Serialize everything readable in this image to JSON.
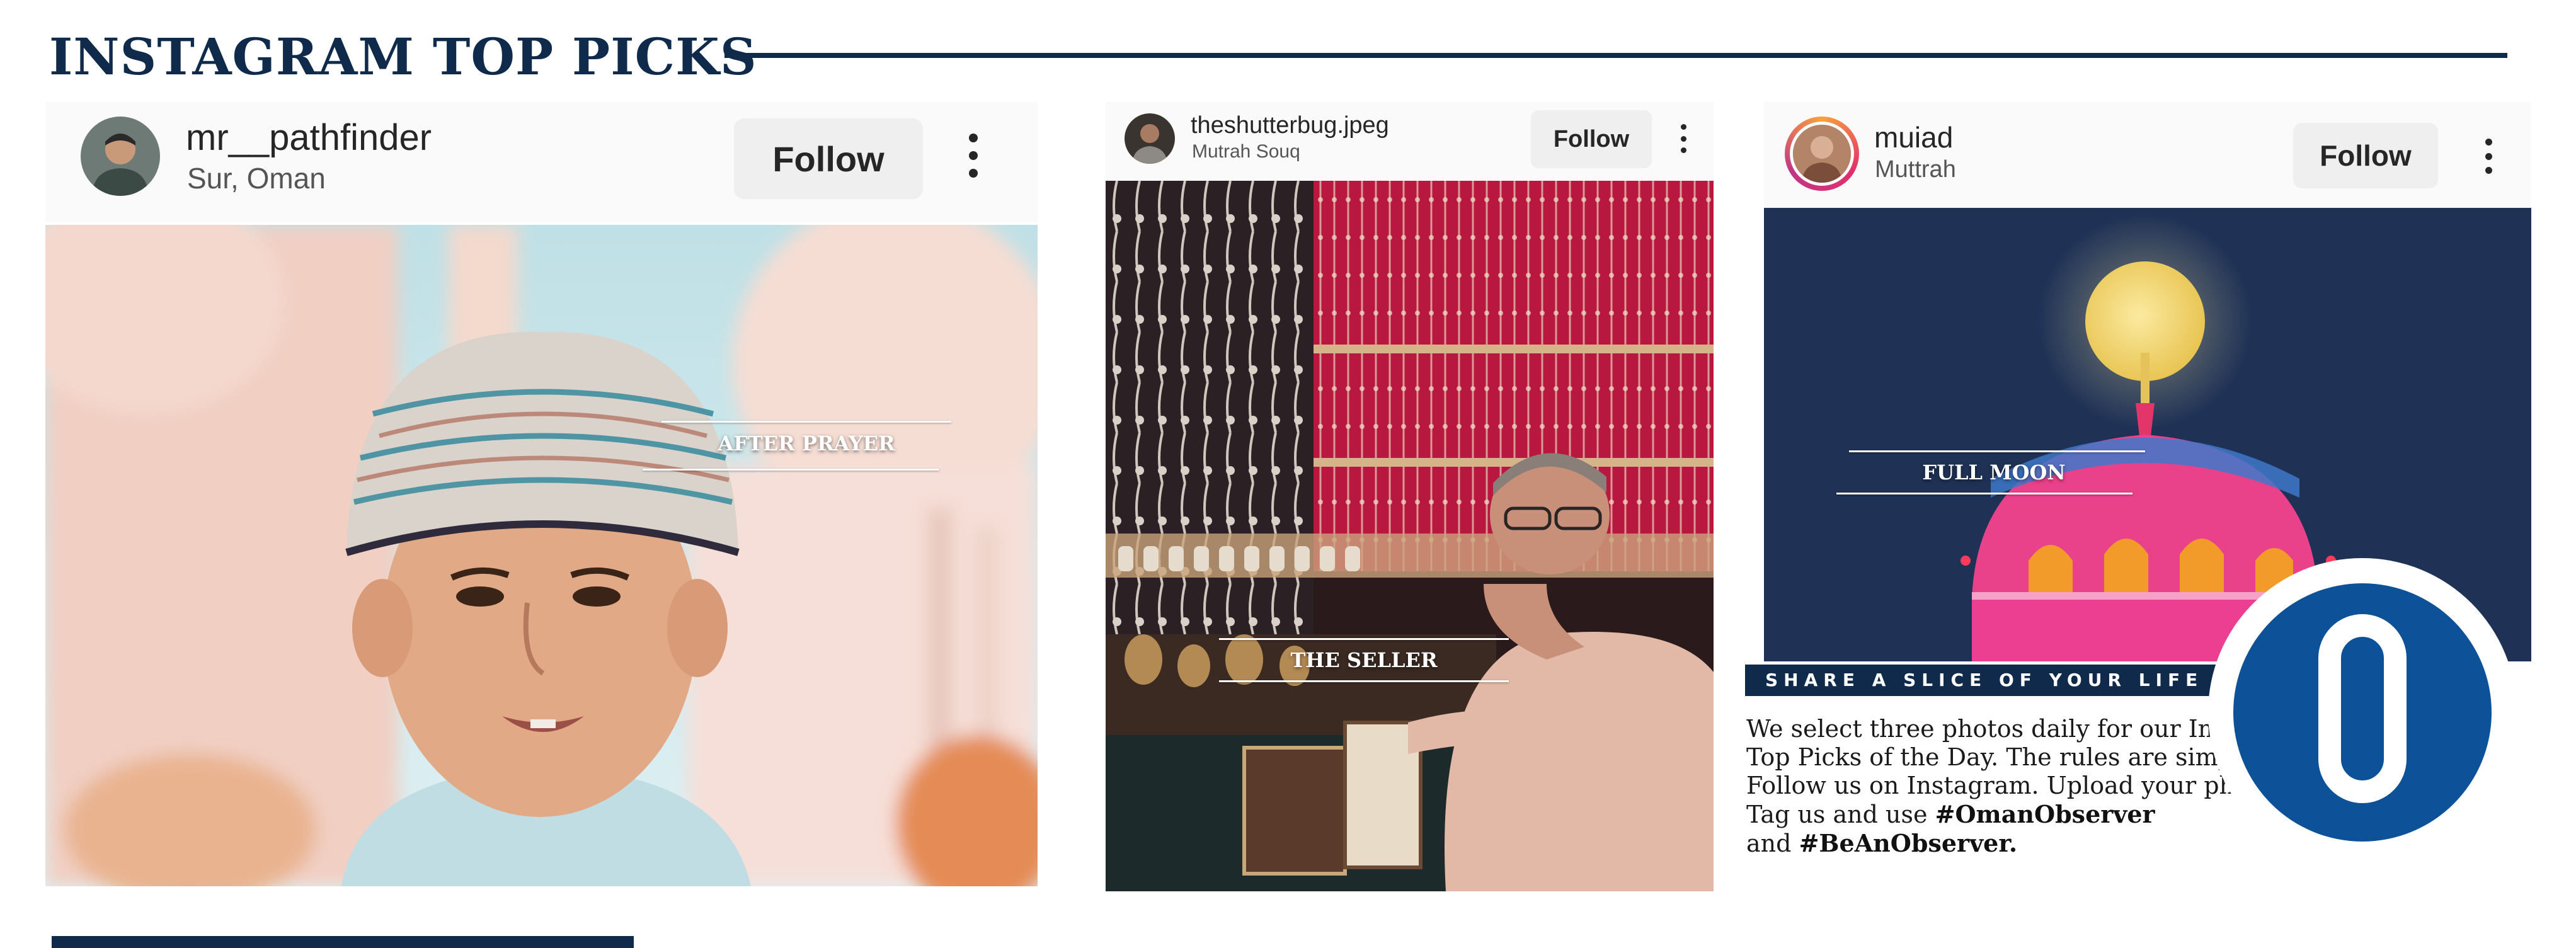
{
  "header": {
    "title": "INSTAGRAM TOP PICKS"
  },
  "posts": [
    {
      "username": "mr__pathfinder",
      "location": "Sur, Oman",
      "follow_label": "Follow",
      "caption": "AFTER PRAYER",
      "avatar_icon": "man-portrait-icon",
      "photo_subject": "boy-in-kummah-cap"
    },
    {
      "username": "theshutterbug.jpeg",
      "location": "Mutrah Souq",
      "follow_label": "Follow",
      "caption": "THE SELLER",
      "avatar_icon": "man-portrait-icon",
      "photo_subject": "souq-jewellery-seller"
    },
    {
      "username": "muiad",
      "location": "Muttrah",
      "follow_label": "Follow",
      "caption": "FULL MOON",
      "avatar_icon": "man-portrait-icon",
      "photo_subject": "moon-over-dome"
    }
  ],
  "sidebar": {
    "banner": "SHARE A SLICE OF YOUR LIFE",
    "intro": "We select three photos daily for our Instagram Top Picks of the Day. The rules are simple. Follow us on Instagram. Upload your photos. Tag us and use",
    "hashtag1": "#OmanObserver",
    "and": "and",
    "hashtag2": "#BeAnObserver.",
    "logo_icon": "oman-observer-logo-icon"
  },
  "colors": {
    "navy": "#0f2a4a",
    "logo_blue": "#0d5298",
    "follow_bg": "#efefef",
    "text": "#262626"
  }
}
